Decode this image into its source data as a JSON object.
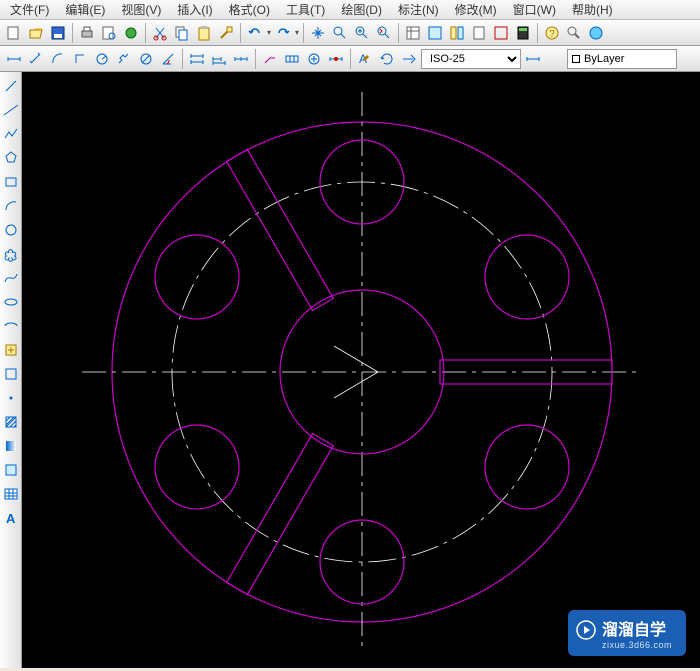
{
  "menu": {
    "file": "文件(F)",
    "edit": "编辑(E)",
    "view": "视图(V)",
    "insert": "插入(I)",
    "format": "格式(O)",
    "tools": "工具(T)",
    "draw": "绘图(D)",
    "annotate": "标注(N)",
    "modify": "修改(M)",
    "window": "窗口(W)",
    "help": "帮助(H)"
  },
  "toolbar3": {
    "dimstyle": "ISO-25",
    "layer": "ByLayer"
  },
  "watermark": {
    "title": "溜溜自学",
    "url": "zixue.3d66.com"
  },
  "icons": {
    "new": "new-icon",
    "open": "open-icon",
    "save": "save-icon",
    "cut": "cut-icon",
    "copy": "copy-icon",
    "paste": "paste-icon",
    "undo": "undo-icon",
    "redo": "redo-icon",
    "pan": "pan-icon",
    "zoom": "zoom-icon",
    "line": "line-icon",
    "arc": "arc-icon",
    "circle": "circle-icon"
  }
}
